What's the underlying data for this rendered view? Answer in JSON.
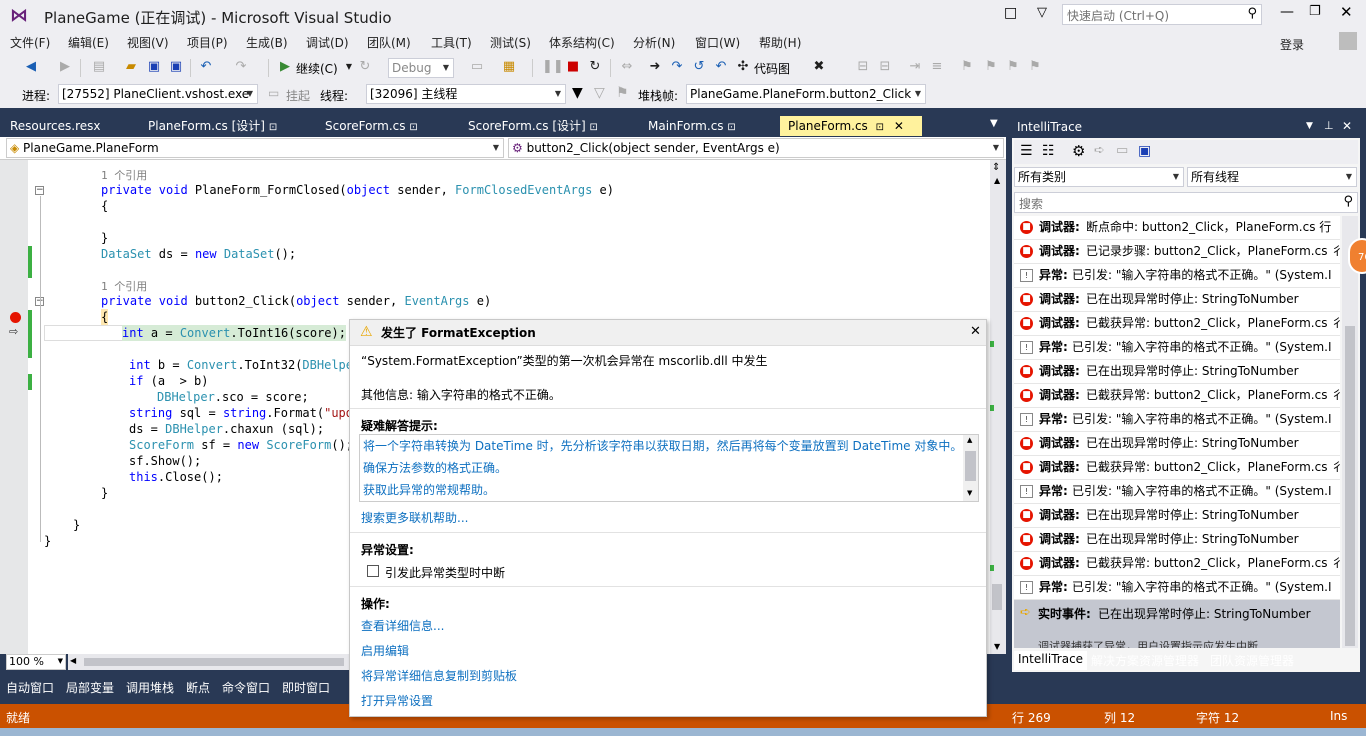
{
  "window": {
    "title": "PlaneGame (正在调试) - Microsoft Visual Studio",
    "quick_launch_placeholder": "快速启动 (Ctrl+Q)",
    "login": "登录"
  },
  "menu": [
    "文件(F)",
    "编辑(E)",
    "视图(V)",
    "项目(P)",
    "生成(B)",
    "调试(D)",
    "团队(M)",
    "工具(T)",
    "测试(S)",
    "体系结构(C)",
    "分析(N)",
    "窗口(W)",
    "帮助(H)"
  ],
  "toolbar": {
    "continue_label": "继续(C)",
    "config_value": "Debug",
    "codemap_label": "代码图"
  },
  "debug_bar": {
    "process_label": "进程:",
    "process_value": "[27552] PlaneClient.vshost.exe",
    "suspend_label": "挂起",
    "thread_label": "线程:",
    "thread_value": "[32096] 主线程",
    "stackframe_label": "堆栈帧:",
    "stackframe_value": "PlaneGame.PlaneForm.button2_Click"
  },
  "doc_tabs": [
    {
      "label": "Resources.resx"
    },
    {
      "label": "PlaneForm.cs [设计]"
    },
    {
      "label": "ScoreForm.cs"
    },
    {
      "label": "ScoreForm.cs [设计]"
    },
    {
      "label": "MainForm.cs"
    },
    {
      "label": "PlaneForm.cs"
    }
  ],
  "nav": {
    "class_value": "PlaneGame.PlaneForm",
    "member_value": "button2_Click(object sender, EventArgs e)"
  },
  "code": {
    "ref1": "1 个引用",
    "line_formclosed": "private void PlaneForm_FormClosed(object sender, FormClosedEventArgs e)",
    "brace_open": "{",
    "brace_close": "}",
    "dataset": "DataSet ds = new DataSet();",
    "ref2": "1 个引用",
    "line_click": "private void button2_Click(object sender, EventArgs e)",
    "l_int_a": "int a = Convert.ToInt16(score);",
    "l_int_b": "int b = Convert.ToInt32(DBHelper",
    "l_if": "if (a  > b)",
    "l_sco": "DBHelper.sco = score;",
    "l_sql": "string sql = string.Format(\"upda",
    "l_ds": "ds = DBHelper.chaxun (sql);",
    "l_sf": "ScoreForm sf = new ScoreForm();",
    "l_show": "sf.Show();",
    "l_close": "this.Close();"
  },
  "exception": {
    "title": "发生了 FormatException",
    "message": "“System.FormatException”类型的第一次机会异常在 mscorlib.dll 中发生",
    "additional": "其他信息: 输入字符串的格式不正确。",
    "tips_heading": "疑难解答提示:",
    "tips": [
      "将一个字符串转换为 DateTime 时，先分析该字符串以获取日期，然后再将每个变量放置到 DateTime 对象中。",
      "确保方法参数的格式正确。",
      "获取此异常的常规帮助。"
    ],
    "search_more": "搜索更多联机帮助...",
    "settings_heading": "异常设置:",
    "break_checkbox": "引发此异常类型时中断",
    "actions_heading": "操作:",
    "actions": [
      "查看详细信息...",
      "启用编辑",
      "将异常详细信息复制到剪贴板",
      "打开异常设置"
    ]
  },
  "intellitrace": {
    "title": "IntelliTrace",
    "category_value": "所有类别",
    "thread_value": "所有线程",
    "search_placeholder": "搜索",
    "events": [
      {
        "kind": "debugger",
        "label": "调试器:",
        "text": "断点命中: button2_Click，PlaneForm.cs 行"
      },
      {
        "kind": "debugger",
        "label": "调试器:",
        "text": "已记录步骤: button2_Click，PlaneForm.cs 彳"
      },
      {
        "kind": "exception",
        "label": "异常:",
        "text": "已引发: \"输入字符串的格式不正确。\" (System.I"
      },
      {
        "kind": "debugger",
        "label": "调试器:",
        "text": "已在出现异常时停止: StringToNumber"
      },
      {
        "kind": "debugger",
        "label": "调试器:",
        "text": "已截获异常: button2_Click，PlaneForm.cs 彳"
      },
      {
        "kind": "exception",
        "label": "异常:",
        "text": "已引发: \"输入字符串的格式不正确。\" (System.I"
      },
      {
        "kind": "debugger",
        "label": "调试器:",
        "text": "已在出现异常时停止: StringToNumber"
      },
      {
        "kind": "debugger",
        "label": "调试器:",
        "text": "已截获异常: button2_Click，PlaneForm.cs 彳"
      },
      {
        "kind": "exception",
        "label": "异常:",
        "text": "已引发: \"输入字符串的格式不正确。\" (System.I"
      },
      {
        "kind": "debugger",
        "label": "调试器:",
        "text": "已在出现异常时停止: StringToNumber"
      },
      {
        "kind": "debugger",
        "label": "调试器:",
        "text": "已截获异常: button2_Click，PlaneForm.cs 彳"
      },
      {
        "kind": "exception",
        "label": "异常:",
        "text": "已引发: \"输入字符串的格式不正确。\" (System.I"
      },
      {
        "kind": "debugger",
        "label": "调试器:",
        "text": "已在出现异常时停止: StringToNumber"
      },
      {
        "kind": "debugger",
        "label": "调试器:",
        "text": "已在出现异常时停止: StringToNumber"
      },
      {
        "kind": "debugger",
        "label": "调试器:",
        "text": "已截获异常: button2_Click，PlaneForm.cs 彳"
      },
      {
        "kind": "exception",
        "label": "异常:",
        "text": "已引发: \"输入字符串的格式不正确。\" (System.I"
      }
    ],
    "live_label": "实时事件:",
    "live_text": "已在出现异常时停止: StringToNumber",
    "live_sub": "调试器捕获了异常，用户设置指示应发生中断",
    "tabs": [
      "IntelliTrace",
      "解决方案资源管理器",
      "团队资源管理器"
    ],
    "badge": "76"
  },
  "zoom": "100 %",
  "bottom_tabs": [
    "自动窗口",
    "局部变量",
    "调用堆栈",
    "断点",
    "命令窗口",
    "即时窗口"
  ],
  "status": {
    "state": "就绪",
    "line": "行 269",
    "col": "列 12",
    "char": "字符 12",
    "mode": "Ins"
  }
}
